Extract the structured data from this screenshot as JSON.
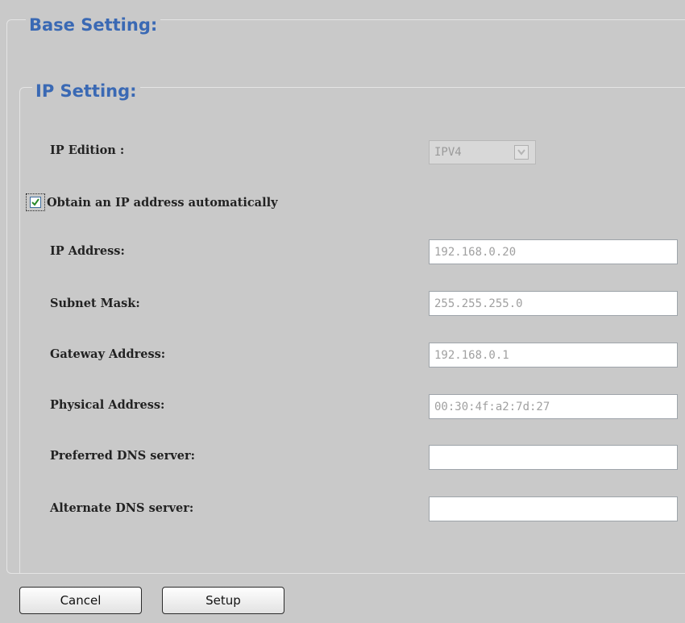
{
  "base_setting": {
    "legend": "Base Setting:"
  },
  "ip_setting": {
    "legend": "IP Setting:",
    "ip_edition": {
      "label": "IP Edition :",
      "selected": "IPV4"
    },
    "obtain_auto": {
      "label": "Obtain an IP address automatically",
      "checked": true
    },
    "fields": [
      {
        "label": "IP Address:",
        "value": "192.168.0.20"
      },
      {
        "label": "Subnet Mask:",
        "value": "255.255.255.0"
      },
      {
        "label": "Gateway Address:",
        "value": "192.168.0.1"
      },
      {
        "label": "Physical Address:",
        "value": "00:30:4f:a2:7d:27"
      },
      {
        "label": "Preferred DNS server:",
        "value": ""
      },
      {
        "label": "Alternate DNS server:",
        "value": ""
      }
    ]
  },
  "actions": {
    "cancel_label": "Cancel",
    "setup_label": "Setup"
  },
  "colors": {
    "background": "#c9c9c9",
    "legend_text": "#3a69b4",
    "checkmark": "#2a8a2a",
    "disabled_text": "#a0a0a0"
  }
}
